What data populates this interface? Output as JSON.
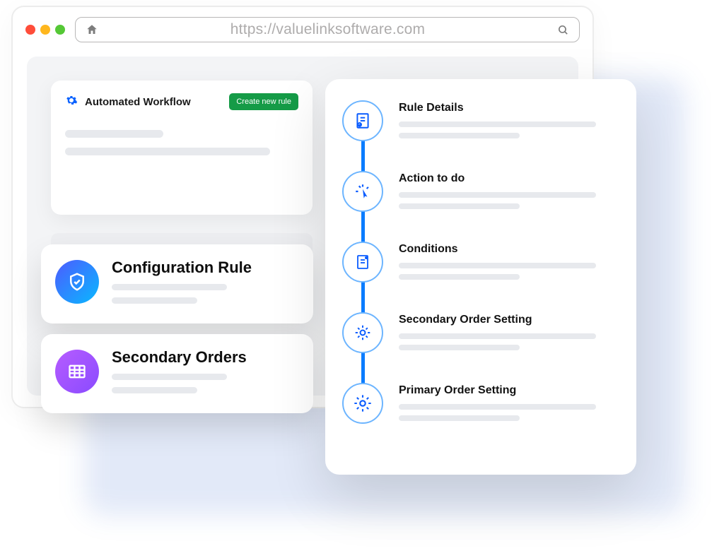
{
  "browser": {
    "url": "https://valuelinksoftware.com"
  },
  "workflow": {
    "title": "Automated Workflow",
    "create_button_label": "Create new rule"
  },
  "cards": {
    "configuration": {
      "title": "Configuration Rule"
    },
    "secondary_orders": {
      "title": "Secondary Orders"
    }
  },
  "steps": [
    {
      "title": "Rule Details"
    },
    {
      "title": "Action to do"
    },
    {
      "title": "Conditions"
    },
    {
      "title": "Secondary Order Setting"
    },
    {
      "title": "Primary Order Setting"
    }
  ]
}
